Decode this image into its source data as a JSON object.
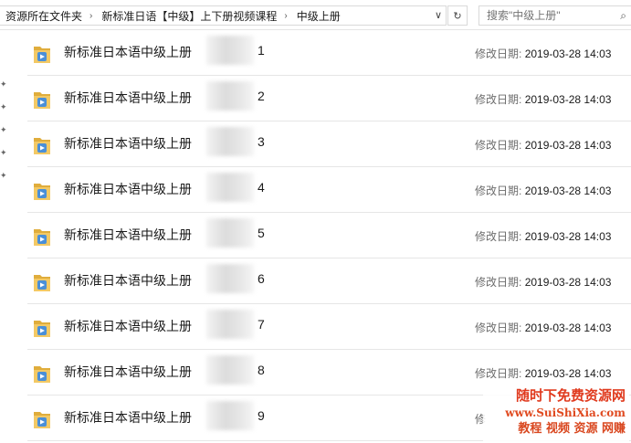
{
  "breadcrumb": [
    "资源所在文件夹",
    "新标准日语【中级】上下册视频课程",
    "中级上册"
  ],
  "search": {
    "placeholder": "搜索\"中级上册\""
  },
  "files": [
    {
      "name": "新标准日本语中级上册",
      "num": "1",
      "meta_label": "修改日期:",
      "date": "2019-03-28 14:03"
    },
    {
      "name": "新标准日本语中级上册",
      "num": "2",
      "meta_label": "修改日期:",
      "date": "2019-03-28 14:03"
    },
    {
      "name": "新标准日本语中级上册",
      "num": "3",
      "meta_label": "修改日期:",
      "date": "2019-03-28 14:03"
    },
    {
      "name": "新标准日本语中级上册",
      "num": "4",
      "meta_label": "修改日期:",
      "date": "2019-03-28 14:03"
    },
    {
      "name": "新标准日本语中级上册",
      "num": "5",
      "meta_label": "修改日期:",
      "date": "2019-03-28 14:03"
    },
    {
      "name": "新标准日本语中级上册",
      "num": "6",
      "meta_label": "修改日期:",
      "date": "2019-03-28 14:03"
    },
    {
      "name": "新标准日本语中级上册",
      "num": "7",
      "meta_label": "修改日期:",
      "date": "2019-03-28 14:03"
    },
    {
      "name": "新标准日本语中级上册",
      "num": "8",
      "meta_label": "修改日期:",
      "date": "2019-03-28 14:03"
    },
    {
      "name": "新标准日本语中级上册",
      "num": "9",
      "meta_label": "修",
      "date": ""
    }
  ],
  "watermark": {
    "line1": "随时下免费资源网",
    "line2": "www.SuiShiXia.com",
    "line3": "教程 视频 资源 网赚"
  },
  "colors": {
    "folder": "#f3c965",
    "folder_dark": "#e0ad3c",
    "media_badge": "#4a8fd8",
    "watermark": "#e03a1e"
  }
}
